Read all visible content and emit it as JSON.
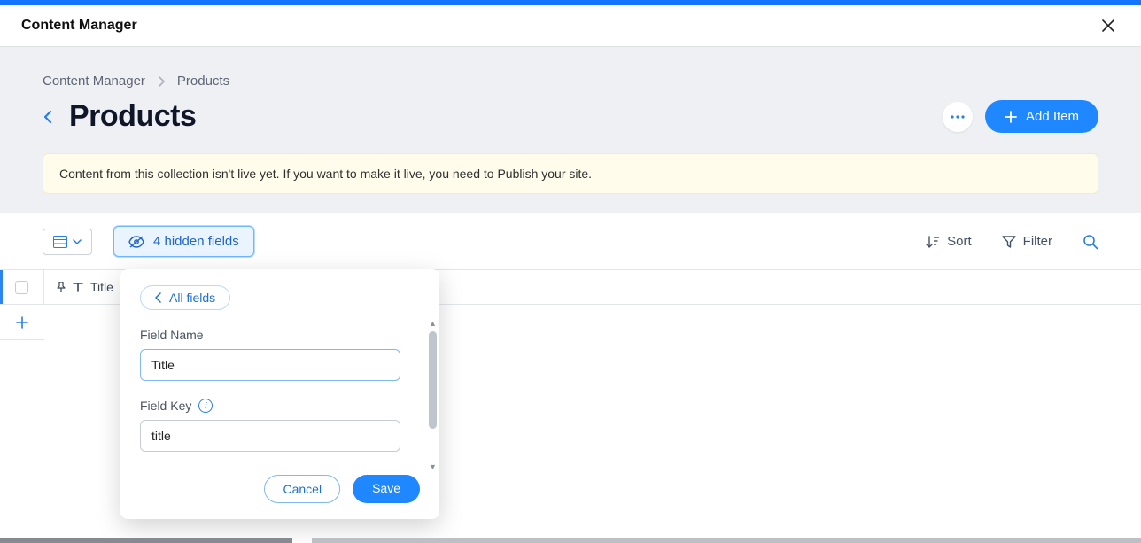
{
  "titlebar": {
    "title": "Content Manager"
  },
  "breadcrumb": {
    "root": "Content Manager",
    "current": "Products"
  },
  "page": {
    "title": "Products"
  },
  "actions": {
    "add_item": "Add Item"
  },
  "banner": {
    "text": "Content from this collection isn't live yet. If you want to make it live, you need to Publish your site."
  },
  "toolbar": {
    "hidden_fields": "4 hidden fields",
    "sort": "Sort",
    "filter": "Filter"
  },
  "columns": {
    "title": "Title"
  },
  "popover": {
    "all_fields": "All fields",
    "field_name_label": "Field Name",
    "field_name_value": "Title",
    "field_key_label": "Field Key",
    "field_key_value": "title",
    "cancel": "Cancel",
    "save": "Save"
  }
}
